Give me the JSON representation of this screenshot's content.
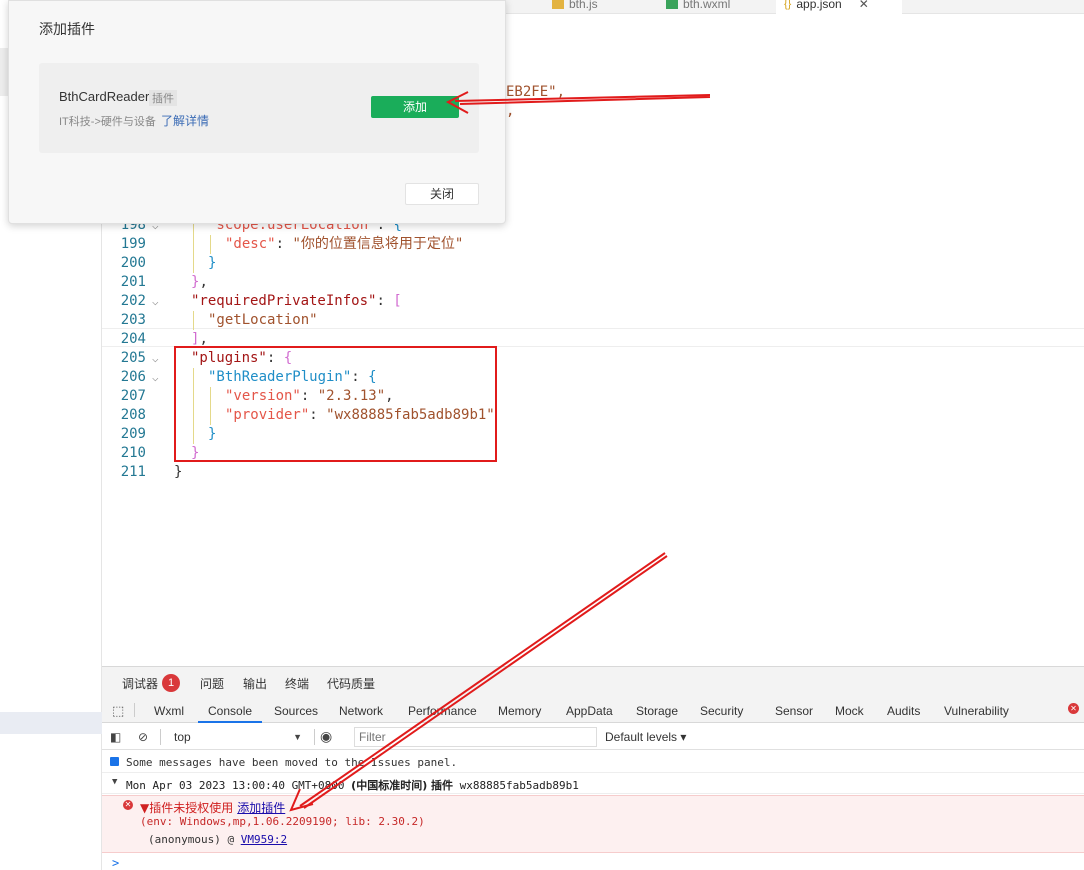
{
  "tabs": [
    {
      "label": "bth.js",
      "icon": "js-file-icon"
    },
    {
      "label": "bth.wxml",
      "icon": "wxml-file-icon"
    },
    {
      "label": "app.json",
      "icon": "json-file-icon",
      "close": "✕"
    }
  ],
  "editor_fragments": {
    "top_value": "EB2FE\",",
    "top_comma": ","
  },
  "code_lines": [
    {
      "n": "198",
      "fold": "v",
      "indent": 2,
      "parts": [
        {
          "t": "\"scope.userLocation\"",
          "c": "k2"
        },
        {
          "t": ": ",
          "c": "p"
        },
        {
          "t": "{",
          "c": "br2"
        }
      ]
    },
    {
      "n": "199",
      "fold": "",
      "indent": 3,
      "parts": [
        {
          "t": "\"desc\"",
          "c": "k2"
        },
        {
          "t": ": ",
          "c": "p"
        },
        {
          "t": "\"你的位置信息将用于定位\"",
          "c": "s"
        }
      ]
    },
    {
      "n": "200",
      "fold": "",
      "indent": 2,
      "parts": [
        {
          "t": "}",
          "c": "br2"
        }
      ]
    },
    {
      "n": "201",
      "fold": "",
      "indent": 1,
      "parts": [
        {
          "t": "}",
          "c": "br1"
        },
        {
          "t": ",",
          "c": "p"
        }
      ]
    },
    {
      "n": "202",
      "fold": "v",
      "indent": 1,
      "parts": [
        {
          "t": "\"requiredPrivateInfos\"",
          "c": "k"
        },
        {
          "t": ": ",
          "c": "p"
        },
        {
          "t": "[",
          "c": "br1"
        }
      ]
    },
    {
      "n": "203",
      "fold": "",
      "indent": 2,
      "parts": [
        {
          "t": "\"getLocation\"",
          "c": "s"
        }
      ]
    },
    {
      "n": "204",
      "fold": "",
      "indent": 1,
      "parts": [
        {
          "t": "]",
          "c": "br1"
        },
        {
          "t": ",",
          "c": "p"
        }
      ]
    },
    {
      "n": "205",
      "fold": "v",
      "indent": 1,
      "parts": [
        {
          "t": "\"plugins\"",
          "c": "k"
        },
        {
          "t": ": ",
          "c": "p"
        },
        {
          "t": "{",
          "c": "br1"
        }
      ]
    },
    {
      "n": "206",
      "fold": "v",
      "indent": 2,
      "parts": [
        {
          "t": "\"BthReaderPlugin\"",
          "c": "br2"
        },
        {
          "t": ": ",
          "c": "p"
        },
        {
          "t": "{",
          "c": "br2"
        }
      ]
    },
    {
      "n": "207",
      "fold": "",
      "indent": 3,
      "parts": [
        {
          "t": "\"version\"",
          "c": "k2"
        },
        {
          "t": ": ",
          "c": "p"
        },
        {
          "t": "\"2.3.13\"",
          "c": "s"
        },
        {
          "t": ",",
          "c": "p"
        }
      ]
    },
    {
      "n": "208",
      "fold": "",
      "indent": 3,
      "parts": [
        {
          "t": "\"provider\"",
          "c": "k2"
        },
        {
          "t": ": ",
          "c": "p"
        },
        {
          "t": "\"wx88885fab5adb89b1\"",
          "c": "s"
        }
      ]
    },
    {
      "n": "209",
      "fold": "",
      "indent": 2,
      "parts": [
        {
          "t": "}",
          "c": "br2"
        }
      ]
    },
    {
      "n": "210",
      "fold": "",
      "indent": 1,
      "parts": [
        {
          "t": "}",
          "c": "br1"
        }
      ]
    },
    {
      "n": "211",
      "fold": "",
      "indent": 0,
      "parts": [
        {
          "t": "}",
          "c": "p"
        }
      ]
    }
  ],
  "modal": {
    "title": "添加插件",
    "plugin_name": "BthCardReader",
    "plugin_tag": "插件",
    "category": "IT科技->硬件与设备",
    "more_link": "了解详情",
    "add_button": "添加",
    "close_button": "关闭"
  },
  "devtools": {
    "top_tabs": [
      "调试器",
      "问题",
      "输出",
      "终端",
      "代码质量"
    ],
    "badge_count": "1",
    "panel_tabs": [
      "Wxml",
      "Console",
      "Sources",
      "Network",
      "Performance",
      "Memory",
      "AppData",
      "Storage",
      "Security",
      "Sensor",
      "Mock",
      "Audits",
      "Vulnerability"
    ],
    "active_panel": "Console",
    "context": "top",
    "filter_placeholder": "Filter",
    "levels": "Default levels",
    "messages": {
      "info": "Some messages have been moved to the Issues panel.",
      "group_date": "Mon Apr 03 2023 13:00:40 GMT+0800 ",
      "group_zone": "(中国标准时间) 插件",
      "group_id": " wx88885fab5adb89b1",
      "error_text": "▼插件未授权使用",
      "error_link": "添加插件",
      "error_env": "(env: Windows,mp,1.06.2209190; lib: 2.30.2)",
      "stack_prefix": "(anonymous) @ ",
      "stack_link": "VM959:2"
    },
    "prompt": ">"
  },
  "colors": {
    "accent_green": "#1aad5a",
    "annotation_red": "#e11b1b",
    "error_bg": "#fdf0f0"
  }
}
